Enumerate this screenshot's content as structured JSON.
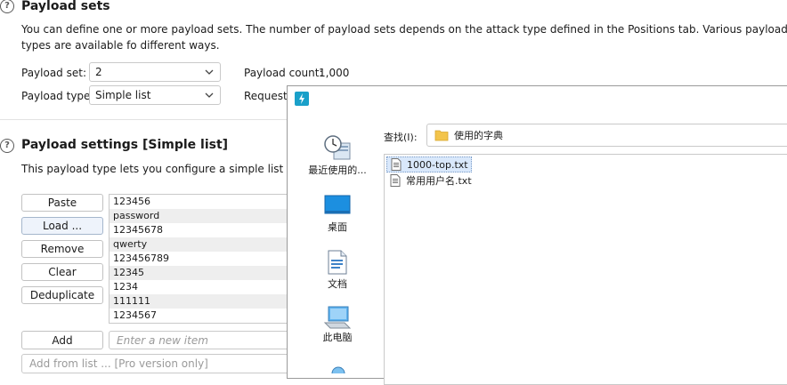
{
  "payload_sets": {
    "title": "Payload sets",
    "description": "You can define one or more payload sets. The number of payload sets depends on the attack type defined in the Positions tab. Various payload types are available fo different ways.",
    "set_label": "Payload set:",
    "set_value": "2",
    "type_label": "Payload type:",
    "type_value": "Simple list",
    "count_label": "Payload count:",
    "count_value": "1,000",
    "request_label": "Request c"
  },
  "payload_settings": {
    "title": "Payload settings [Simple list]",
    "description": "This payload type lets you configure a simple list of string",
    "buttons": {
      "paste": "Paste",
      "load": "Load ...",
      "remove": "Remove",
      "clear": "Clear",
      "deduplicate": "Deduplicate",
      "add": "Add"
    },
    "items": [
      "123456",
      "password",
      "12345678",
      "qwerty",
      "123456789",
      "12345",
      "1234",
      "111111",
      "1234567"
    ],
    "add_placeholder": "Enter a new item",
    "add_from_list": "Add from list ... [Pro version only]"
  },
  "dialog": {
    "app_icon": "burp-lightning-icon",
    "lookin_label": "查找(I):",
    "lookin_value": "使用的字典",
    "nav": [
      {
        "label": "最近使用的...",
        "icon": "recent-clock-icon"
      },
      {
        "label": "桌面",
        "icon": "desktop-icon"
      },
      {
        "label": "文档",
        "icon": "documents-icon"
      },
      {
        "label": "此电脑",
        "icon": "computer-icon"
      }
    ],
    "files": [
      {
        "name": "1000-top.txt",
        "icon": "text-file-icon"
      },
      {
        "name": "常用用户名.txt",
        "icon": "text-file-icon"
      }
    ]
  },
  "colors": {
    "title_text": "#1b1b1b",
    "selection": "#d9e8fb",
    "folder": "#f3c44b",
    "burp_icon": "#1aa0c9"
  }
}
